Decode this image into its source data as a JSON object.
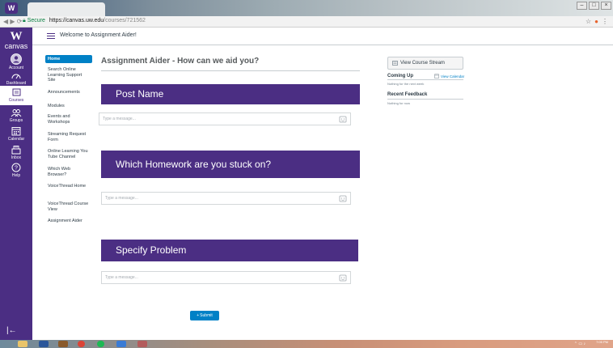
{
  "browser": {
    "tab_favicon": "W",
    "secure_label": "Secure",
    "url_host": "https://canvas.uw.edu",
    "url_path": "/courses/721562"
  },
  "global_nav": {
    "logo_mark": "W",
    "logo_text": "canvas",
    "items": [
      {
        "label": "Account",
        "icon": "account-icon"
      },
      {
        "label": "Dashboard",
        "icon": "dashboard-icon"
      },
      {
        "label": "Courses",
        "icon": "courses-icon"
      },
      {
        "label": "Groups",
        "icon": "groups-icon"
      },
      {
        "label": "Calendar",
        "icon": "calendar-icon"
      },
      {
        "label": "Inbox",
        "icon": "inbox-icon"
      },
      {
        "label": "Help",
        "icon": "help-icon"
      }
    ]
  },
  "header": {
    "course_title": "Welcome to Assignment Aider!"
  },
  "course_nav": [
    "Home",
    "Search Online Learning Support Site",
    "Announcements",
    "Modules",
    "Events and Workshops",
    "Streaming Request Form",
    "Online Learning You Tube Channel",
    "Which Web Browser?",
    "VoiceThread Home",
    "VoiceThread Course View",
    "Assignment Aider"
  ],
  "main": {
    "page_title": "Assignment Aider - How can we aid you?",
    "sections": [
      {
        "heading": "Post Name",
        "placeholder": "Type a message..."
      },
      {
        "heading": "Which Homework are you stuck on?",
        "placeholder": "Type a message..."
      },
      {
        "heading": "Specify Problem",
        "placeholder": "Type a message..."
      }
    ],
    "submit_label": "Submit"
  },
  "right_sidebar": {
    "stream_button": "View Course Stream",
    "coming_up": "Coming Up",
    "view_calendar": "View Calendar",
    "coming_up_empty": "Nothing for the next week",
    "recent_feedback": "Recent Feedback",
    "feedback_empty": "Nothing for now"
  },
  "taskbar": {
    "time": "7:05 PM"
  },
  "colors": {
    "brand_purple": "#4b2e83",
    "accent_blue": "#0081c6"
  }
}
